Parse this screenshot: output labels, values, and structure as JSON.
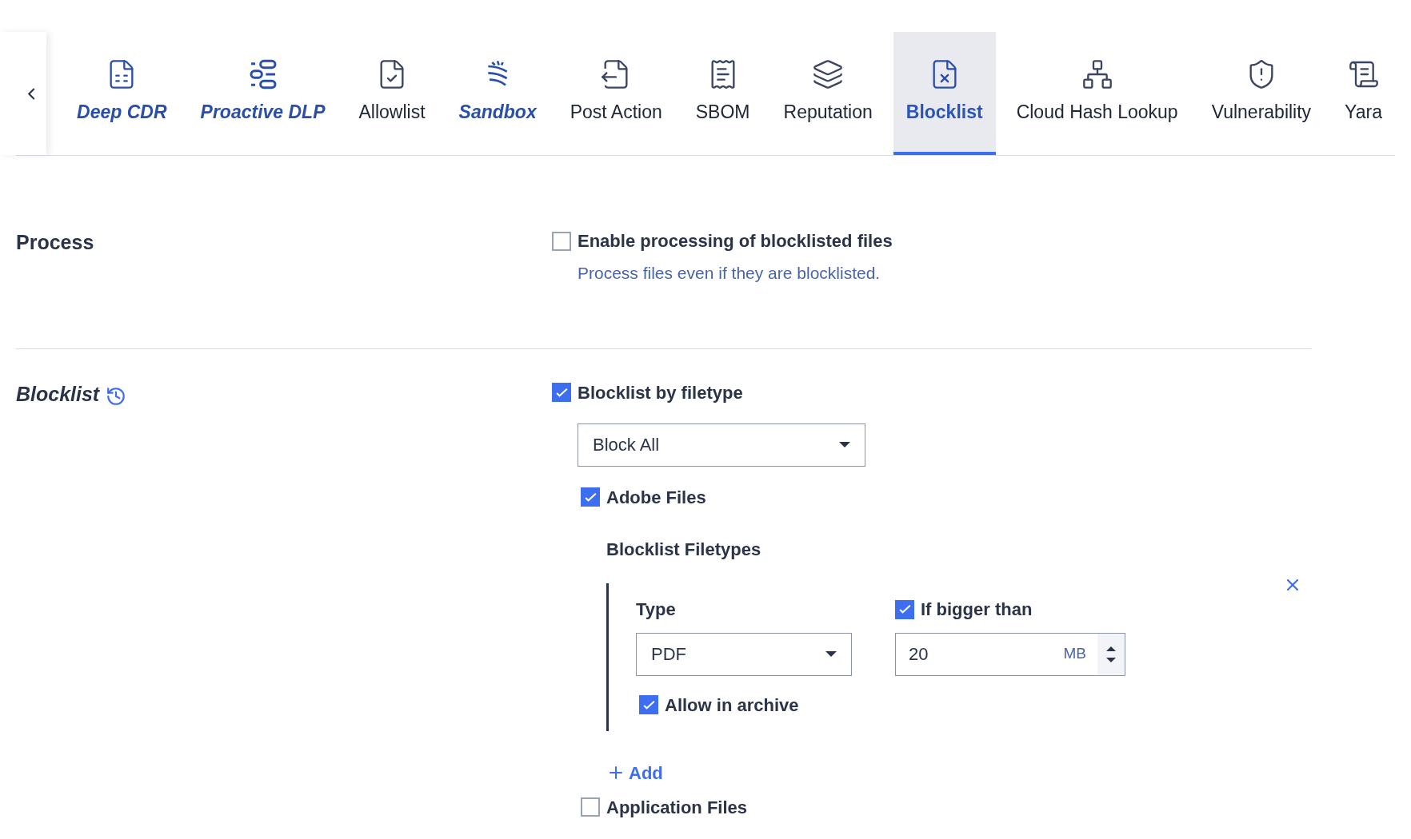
{
  "tabs": [
    {
      "label": "Deep CDR",
      "kind": "featured",
      "selected": false
    },
    {
      "label": "Proactive DLP",
      "kind": "featured",
      "selected": false
    },
    {
      "label": "Allowlist",
      "kind": "plain",
      "selected": false
    },
    {
      "label": "Sandbox",
      "kind": "featured",
      "selected": false
    },
    {
      "label": "Post Action",
      "kind": "plain",
      "selected": false
    },
    {
      "label": "SBOM",
      "kind": "plain",
      "selected": false
    },
    {
      "label": "Reputation",
      "kind": "plain",
      "selected": false
    },
    {
      "label": "Blocklist",
      "kind": "plain",
      "selected": true
    },
    {
      "label": "Cloud Hash Lookup",
      "kind": "plain",
      "selected": false
    },
    {
      "label": "Vulnerability",
      "kind": "plain",
      "selected": false
    },
    {
      "label": "Yara",
      "kind": "plain",
      "selected": false
    }
  ],
  "process": {
    "title": "Process",
    "option": {
      "label": "Enable processing of blocklisted files",
      "checked": false,
      "description": "Process files even if they are blocklisted."
    }
  },
  "blocklist": {
    "title": "Blocklist",
    "by_filetype": {
      "label": "Blocklist by filetype",
      "checked": true
    },
    "mode": "Block All",
    "groups": [
      {
        "label": "Adobe Files",
        "checked": true,
        "filetypes_title": "Blocklist Filetypes",
        "entries": [
          {
            "type_label": "Type",
            "type": "PDF",
            "size_check": {
              "label": "If bigger than",
              "checked": true
            },
            "size": "20",
            "unit": "MB",
            "archive": {
              "label": "Allow in archive",
              "checked": true
            }
          }
        ],
        "add": "Add"
      },
      {
        "label": "Application Files",
        "checked": false
      }
    ]
  }
}
